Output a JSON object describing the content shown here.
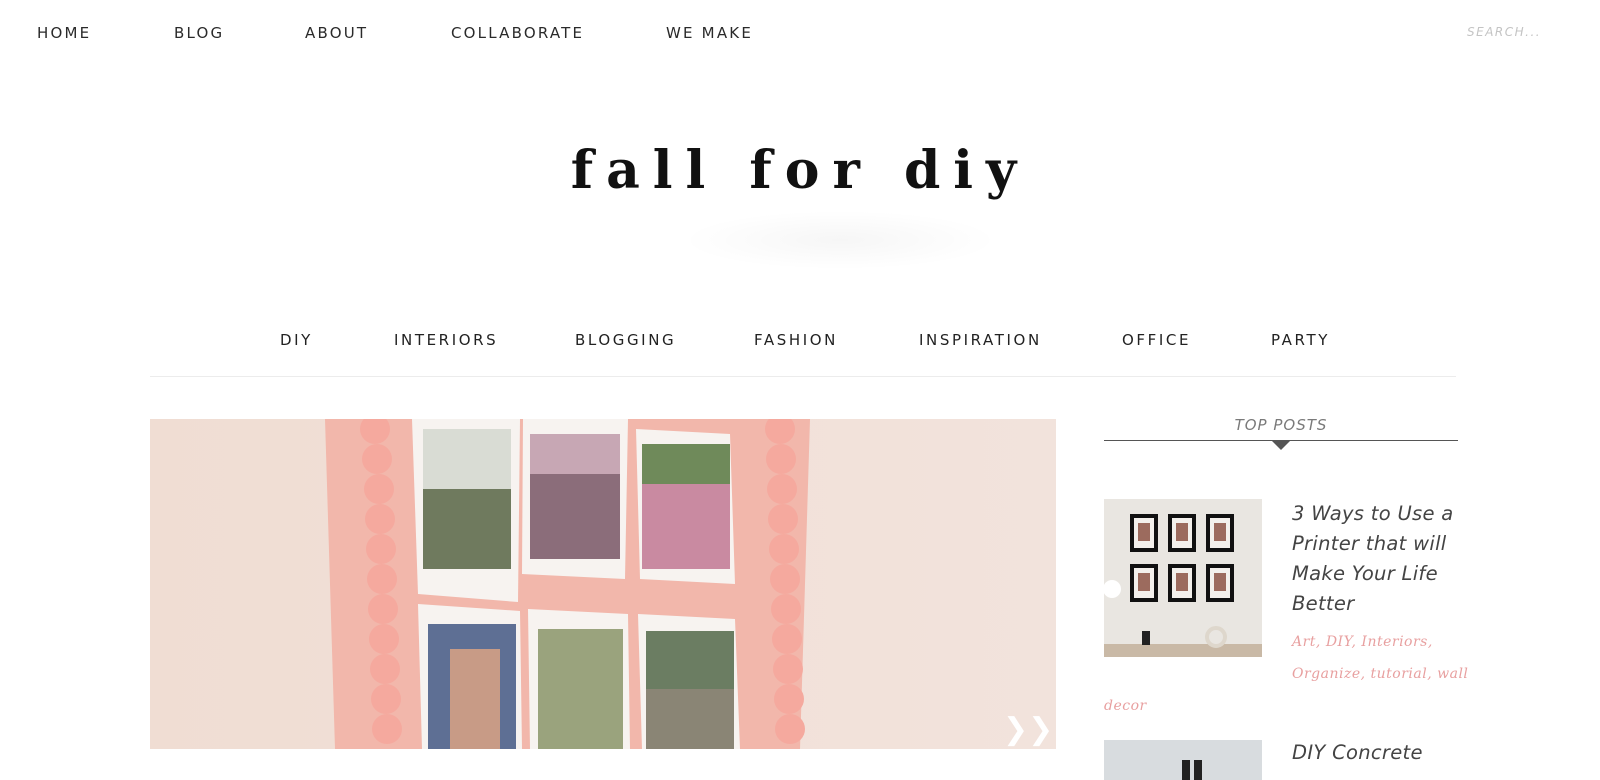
{
  "topnav": {
    "items": [
      {
        "label": "HOME"
      },
      {
        "label": "BLOG"
      },
      {
        "label": "ABOUT"
      },
      {
        "label": "COLLABORATE"
      },
      {
        "label": "WE MAKE"
      }
    ],
    "search_placeholder": "SEARCH..."
  },
  "logo": {
    "text": "fall for diy"
  },
  "categories": [
    {
      "label": "DIY"
    },
    {
      "label": "INTERIORS"
    },
    {
      "label": "BLOGGING"
    },
    {
      "label": "FASHION"
    },
    {
      "label": "INSPIRATION"
    },
    {
      "label": "OFFICE"
    },
    {
      "label": "PARTY"
    }
  ],
  "hero": {
    "next_arrow_icon": "chevron-right-double-icon"
  },
  "sidebar": {
    "widget_title": "TOP POSTS",
    "posts": [
      {
        "title": "3 Ways to Use a Printer that will Make Your Life Better",
        "title_lines": [
          "3 Ways to Use a",
          "Printer that will",
          "Make Your Life",
          "Better"
        ],
        "tags": [
          "Art",
          "DIY",
          "Interiors",
          "Organize",
          "tutorial",
          "wall decor"
        ],
        "tag_line1": "Art, DIY, Interiors,",
        "tag_line2": "Organize, tutorial, wall",
        "tag_line3": "decor"
      },
      {
        "title": "DIY Concrete",
        "title_lines": [
          "DIY Concrete"
        ]
      }
    ]
  },
  "colors": {
    "tag_pink": "#e8a0a0",
    "hero_background": "#eedcd4",
    "frame_pink": "#f1b8ad"
  }
}
